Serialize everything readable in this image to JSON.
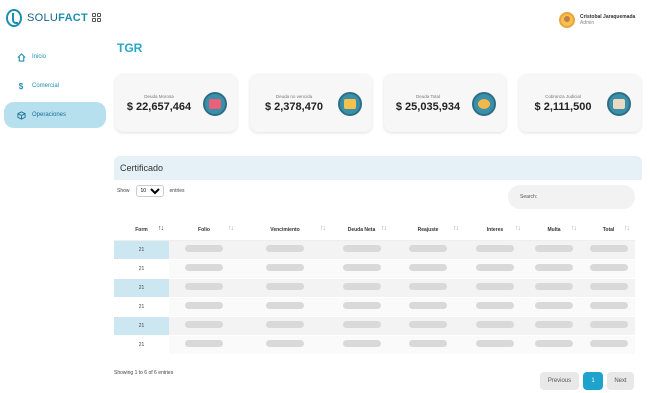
{
  "brand": {
    "prefix": "SOLU",
    "suffix": "FACT"
  },
  "user": {
    "name": "Cristobal Jaraquemada",
    "role": "Admin"
  },
  "sidebar": {
    "items": [
      {
        "label": "Inicio",
        "icon": "home-icon",
        "active": false
      },
      {
        "label": "Comercial",
        "icon": "dollar-icon",
        "active": false
      },
      {
        "label": "Operaciones",
        "icon": "box-icon",
        "active": true
      }
    ]
  },
  "page": {
    "title": "TGR"
  },
  "cards": [
    {
      "label": "Deuda Morosa",
      "value": "$ 22,657,464",
      "icon": "invoice-icon",
      "icon_color": "#e8607a"
    },
    {
      "label": "Deuda no vencida",
      "value": "$ 2,378,470",
      "icon": "calendar-icon",
      "icon_color": "#f2c14e"
    },
    {
      "label": "Deuda Total",
      "value": "$ 25,035,934",
      "icon": "people-icon",
      "icon_color": "#f2b84a"
    },
    {
      "label": "Cobranza Judicial",
      "value": "$ 2,111,500",
      "icon": "courthouse-icon",
      "icon_color": "#e7d9c2"
    }
  ],
  "panel": {
    "title": "Certificado",
    "show_label": "Show",
    "show_value": "10",
    "entries_label": "entries",
    "search_label": "Search:",
    "search_value": ""
  },
  "table": {
    "columns": [
      "Form",
      "Folio",
      "Vencimiento",
      "Deuda Neta",
      "Reajuste",
      "Interes",
      "Multa",
      "Total"
    ],
    "rows": [
      "21",
      "21",
      "21",
      "21",
      "21",
      "21"
    ]
  },
  "footer": {
    "info": "Showing 1 to 6 of 6 entries",
    "prev": "Previous",
    "page": "1",
    "next": "Next"
  },
  "colors": {
    "accent": "#1fa2cc",
    "active_nav": "#b7e0ee",
    "title": "#2aa5c7"
  }
}
